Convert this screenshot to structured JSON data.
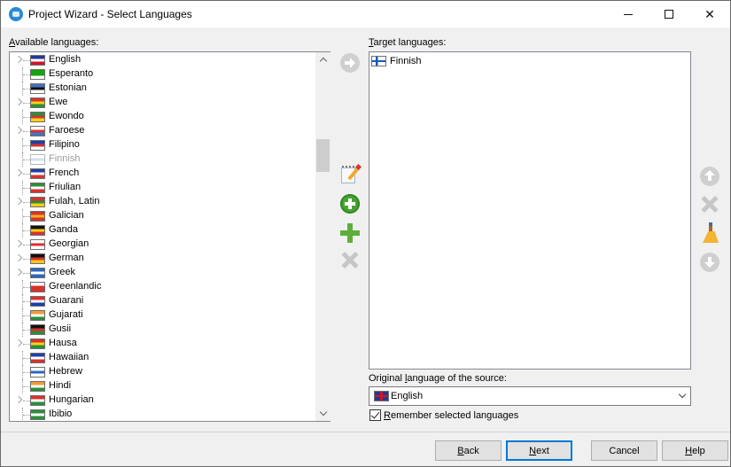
{
  "window": {
    "title": "Project Wizard - Select Languages",
    "controls": [
      "minimize",
      "maximize",
      "close"
    ]
  },
  "available": {
    "label_accesskey": "A",
    "label_rest": "vailable languages:",
    "items": [
      {
        "name": "English",
        "expandable": true,
        "disabled": false,
        "flag": [
          "#1f3a93",
          "#ffffff",
          "#cf142b"
        ]
      },
      {
        "name": "Esperanto",
        "expandable": false,
        "disabled": false,
        "flag": [
          "#15a30f",
          "#15a30f",
          "#ffffff"
        ]
      },
      {
        "name": "Estonian",
        "expandable": false,
        "disabled": false,
        "flag": [
          "#4373c0",
          "#111111",
          "#ffffff"
        ]
      },
      {
        "name": "Ewe",
        "expandable": true,
        "disabled": false,
        "flag": [
          "#d8322e",
          "#f7d214",
          "#2a8f3a"
        ]
      },
      {
        "name": "Ewondo",
        "expandable": false,
        "disabled": false,
        "flag": [
          "#2a8f3a",
          "#d8322e",
          "#f7d214"
        ]
      },
      {
        "name": "Faroese",
        "expandable": true,
        "disabled": false,
        "flag": [
          "#ffffff",
          "#d8322e",
          "#4373c0"
        ]
      },
      {
        "name": "Filipino",
        "expandable": false,
        "disabled": false,
        "flag": [
          "#1c3fa8",
          "#d8322e",
          "#ffffff"
        ]
      },
      {
        "name": "Finnish",
        "expandable": false,
        "disabled": true,
        "flag": [
          "#ffffff",
          "#a7c6e6",
          "#ffffff"
        ]
      },
      {
        "name": "French",
        "expandable": true,
        "disabled": false,
        "flag": [
          "#1c3fa8",
          "#ffffff",
          "#d8322e"
        ]
      },
      {
        "name": "Friulian",
        "expandable": false,
        "disabled": false,
        "flag": [
          "#2a8f3a",
          "#ffffff",
          "#d8322e"
        ]
      },
      {
        "name": "Fulah, Latin",
        "expandable": true,
        "disabled": false,
        "flag": [
          "#d8322e",
          "#2a8f3a",
          "#f7d214"
        ]
      },
      {
        "name": "Galician",
        "expandable": false,
        "disabled": false,
        "flag": [
          "#d8322e",
          "#f7b414",
          "#d8322e"
        ]
      },
      {
        "name": "Ganda",
        "expandable": false,
        "disabled": false,
        "flag": [
          "#111111",
          "#f7d214",
          "#d8322e"
        ]
      },
      {
        "name": "Georgian",
        "expandable": true,
        "disabled": false,
        "flag": [
          "#ffffff",
          "#d8322e",
          "#ffffff"
        ]
      },
      {
        "name": "German",
        "expandable": true,
        "disabled": false,
        "flag": [
          "#111111",
          "#d8322e",
          "#f7c814"
        ]
      },
      {
        "name": "Greek",
        "expandable": true,
        "disabled": false,
        "flag": [
          "#2c67c0",
          "#ffffff",
          "#2c67c0"
        ]
      },
      {
        "name": "Greenlandic",
        "expandable": false,
        "disabled": false,
        "flag": [
          "#ffffff",
          "#d8322e",
          "#d8322e"
        ]
      },
      {
        "name": "Guarani",
        "expandable": false,
        "disabled": false,
        "flag": [
          "#d8322e",
          "#ffffff",
          "#1c3fa8"
        ]
      },
      {
        "name": "Gujarati",
        "expandable": false,
        "disabled": false,
        "flag": [
          "#f59a36",
          "#ffffff",
          "#2a8f3a"
        ]
      },
      {
        "name": "Gusii",
        "expandable": false,
        "disabled": false,
        "flag": [
          "#111111",
          "#d8322e",
          "#2a8f3a"
        ]
      },
      {
        "name": "Hausa",
        "expandable": true,
        "disabled": false,
        "flag": [
          "#d8322e",
          "#f7d214",
          "#2a8f3a"
        ]
      },
      {
        "name": "Hawaiian",
        "expandable": false,
        "disabled": false,
        "flag": [
          "#1c3fa8",
          "#ffffff",
          "#d8322e"
        ]
      },
      {
        "name": "Hebrew",
        "expandable": false,
        "disabled": false,
        "flag": [
          "#ffffff",
          "#2c67c0",
          "#ffffff"
        ]
      },
      {
        "name": "Hindi",
        "expandable": false,
        "disabled": false,
        "flag": [
          "#f59a36",
          "#ffffff",
          "#2a8f3a"
        ]
      },
      {
        "name": "Hungarian",
        "expandable": true,
        "disabled": false,
        "flag": [
          "#d8322e",
          "#ffffff",
          "#2a8f3a"
        ]
      },
      {
        "name": "Ibibio",
        "expandable": false,
        "disabled": false,
        "flag": [
          "#2a8f3a",
          "#ffffff",
          "#2a8f3a"
        ]
      }
    ]
  },
  "target": {
    "label_accesskey": "T",
    "label_rest": "arget languages:",
    "items": [
      {
        "name": "Finnish",
        "flag": [
          "#ffffff",
          "#1c5bb0",
          "#ffffff"
        ]
      }
    ]
  },
  "middle_tools": [
    {
      "name": "add-selected",
      "icon": "arrow-right-circle-icon",
      "enabled": false
    },
    {
      "name": "edit",
      "icon": "notepad-pencil-icon",
      "enabled": true
    },
    {
      "name": "add-new",
      "icon": "plus-circle-icon",
      "enabled": true
    },
    {
      "name": "add",
      "icon": "plus-icon",
      "enabled": true
    },
    {
      "name": "remove",
      "icon": "x-icon",
      "enabled": false
    }
  ],
  "right_tools": [
    {
      "name": "move-up",
      "icon": "arrow-up-circle-icon",
      "enabled": false
    },
    {
      "name": "remove-target",
      "icon": "x-icon",
      "enabled": false
    },
    {
      "name": "clear",
      "icon": "broom-icon",
      "enabled": true
    },
    {
      "name": "move-down",
      "icon": "arrow-down-circle-icon",
      "enabled": false
    }
  ],
  "source": {
    "label_pre": "Original ",
    "label_accesskey": "l",
    "label_rest": "anguage of the source:",
    "selected": "English"
  },
  "remember": {
    "checked": true,
    "label_accesskey": "R",
    "label_rest": "emember selected languages"
  },
  "buttons": {
    "back": {
      "accesskey": "B",
      "rest": "ack"
    },
    "next": {
      "accesskey": "N",
      "rest": "ext"
    },
    "cancel": {
      "label": "Cancel"
    },
    "help": {
      "accesskey": "H",
      "rest": "elp"
    }
  },
  "colors": {
    "accent": "#0078d7",
    "icon_green": "#4aa233",
    "icon_disabled": "#cfcfcf"
  }
}
